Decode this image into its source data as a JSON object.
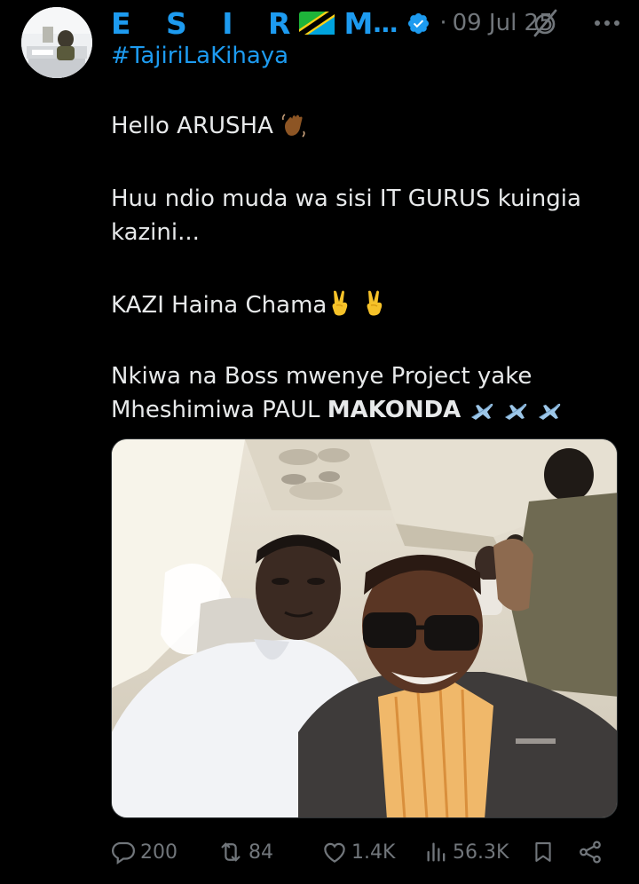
{
  "tweet": {
    "author": {
      "display_name_prefix": "E S I R",
      "display_name_suffix": "M",
      "ellipsis": "…",
      "verified_color": "#1d9bf0"
    },
    "separator": "·",
    "date": "09 Jul 25",
    "hashtag": "#TajiriLaKihaya",
    "lines": {
      "hello": "Hello ARUSHA",
      "gurus_1": "Huu ndio muda wa sisi IT GURUS kuingia",
      "gurus_2": "kazini...",
      "kazi": "KAZI Haina Chama",
      "boss_1": "Nkiwa na Boss mwenye Project yake",
      "boss_2_plain": "Mheshimiwa PAUL ",
      "boss_2_bold": "MAKONDA"
    },
    "icons": {
      "wave": "waving-hand-icon",
      "victory": "victory-hand-icon",
      "airplane": "airplane-icon"
    },
    "metrics": {
      "replies": "200",
      "reposts": "84",
      "likes": "1.4K",
      "views": "56.3K"
    }
  },
  "colors": {
    "background": "#000000",
    "accent": "#1d9bf0",
    "text": "#e7e9ea",
    "muted": "#71767b"
  }
}
